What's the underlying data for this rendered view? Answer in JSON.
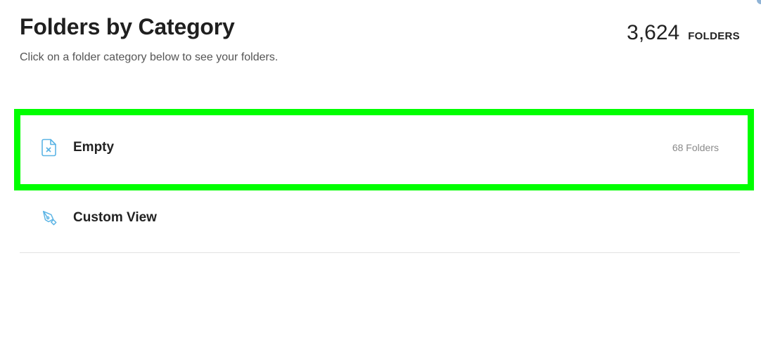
{
  "header": {
    "title": "Folders by Category",
    "subtitle": "Click on a folder category below to see your folders.",
    "total_count": "3,624",
    "total_unit": "FOLDERS"
  },
  "categories": [
    {
      "label": "Empty",
      "count": "68 Folders",
      "icon": "empty-file-icon"
    },
    {
      "label": "Custom View",
      "count": "",
      "icon": "pen-tool-icon"
    }
  ],
  "colors": {
    "icon": "#5bb4e5",
    "highlight": "#00ff00",
    "divider": "#e2e2e2"
  }
}
